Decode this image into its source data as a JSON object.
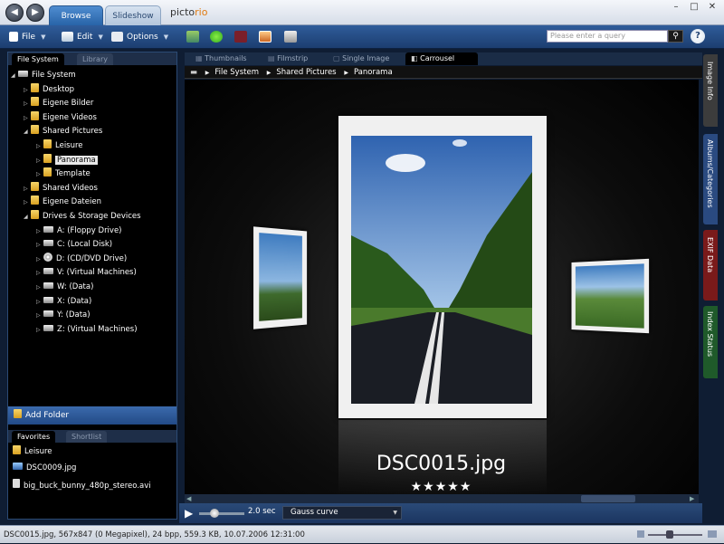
{
  "titlebar": {
    "tabs": [
      {
        "label": "Browse"
      },
      {
        "label": "Slideshow"
      }
    ],
    "logo_prefix": "picto",
    "logo_suffix": "rio"
  },
  "toolbar": {
    "file_label": "File",
    "edit_label": "Edit",
    "options_label": "Options",
    "search_placeholder": "Please enter a query",
    "help_label": "?"
  },
  "left_panel": {
    "tabs": [
      {
        "label": "File System"
      },
      {
        "label": "Library"
      }
    ],
    "tree": [
      {
        "label": "File System",
        "depth": 0,
        "icon": "computer-icon",
        "expanded": true
      },
      {
        "label": "Desktop",
        "depth": 1,
        "icon": "folder-icon"
      },
      {
        "label": "Eigene Bilder",
        "depth": 1,
        "icon": "folder-icon"
      },
      {
        "label": "Eigene Videos",
        "depth": 1,
        "icon": "folder-icon"
      },
      {
        "label": "Shared Pictures",
        "depth": 1,
        "icon": "folder-icon",
        "expanded": true
      },
      {
        "label": "Leisure",
        "depth": 2,
        "icon": "folder-icon"
      },
      {
        "label": "Panorama",
        "depth": 2,
        "icon": "folder-icon",
        "selected": true
      },
      {
        "label": "Template",
        "depth": 2,
        "icon": "folder-icon"
      },
      {
        "label": "Shared Videos",
        "depth": 1,
        "icon": "folder-icon"
      },
      {
        "label": "Eigene Dateien",
        "depth": 1,
        "icon": "folder-icon"
      },
      {
        "label": "Drives & Storage Devices",
        "depth": 1,
        "icon": "folder-icon",
        "expanded": true
      },
      {
        "label": "A: (Floppy Drive)",
        "depth": 2,
        "icon": "floppy-icon"
      },
      {
        "label": "C: (Local Disk)",
        "depth": 2,
        "icon": "disk-icon"
      },
      {
        "label": "D: (CD/DVD Drive)",
        "depth": 2,
        "icon": "cd-icon"
      },
      {
        "label": "V: (Virtual Machines)",
        "depth": 2,
        "icon": "network-drive-icon"
      },
      {
        "label": "W: (Data)",
        "depth": 2,
        "icon": "network-drive-icon"
      },
      {
        "label": "X: (Data)",
        "depth": 2,
        "icon": "network-drive-icon"
      },
      {
        "label": "Y: (Data)",
        "depth": 2,
        "icon": "network-drive-icon"
      },
      {
        "label": "Z: (Virtual Machines)",
        "depth": 2,
        "icon": "network-drive-icon"
      }
    ],
    "add_folder_label": "Add Folder",
    "bottom_tabs": [
      {
        "label": "Favorites"
      },
      {
        "label": "Shortlist"
      }
    ],
    "favorites": [
      {
        "label": "Leisure",
        "icon": "folder-icon"
      },
      {
        "label": "DSC0009.jpg",
        "icon": "image-icon"
      },
      {
        "label": "big_buck_bunny_480p_stereo.avi",
        "icon": "video-icon"
      }
    ]
  },
  "view": {
    "tabs": [
      {
        "label": "Thumbnails",
        "active": false
      },
      {
        "label": "Filmstrip",
        "active": false
      },
      {
        "label": "Single Image",
        "active": false
      },
      {
        "label": "Carrousel",
        "active": true
      }
    ],
    "path": [
      "File System",
      "Shared Pictures",
      "Panorama"
    ],
    "current_image": "DSC0015.jpg",
    "rating_stars": "★★★★★",
    "rating": 5
  },
  "player": {
    "interval": "2.0 sec",
    "transition": "Gauss curve"
  },
  "right_tabs": [
    {
      "label": "Image Info",
      "color": "#3c3c3c"
    },
    {
      "label": "Albums/Categories",
      "color": "#2a4a80"
    },
    {
      "label": "EXIF Data",
      "color": "#7a1a1a"
    },
    {
      "label": "Index Status",
      "color": "#1f5a2a"
    }
  ],
  "status": {
    "text": "DSC0015.jpg, 567x847 (0 Megapixel), 24 bpp, 559.3 KB, 10.07.2006 12:31:00"
  }
}
